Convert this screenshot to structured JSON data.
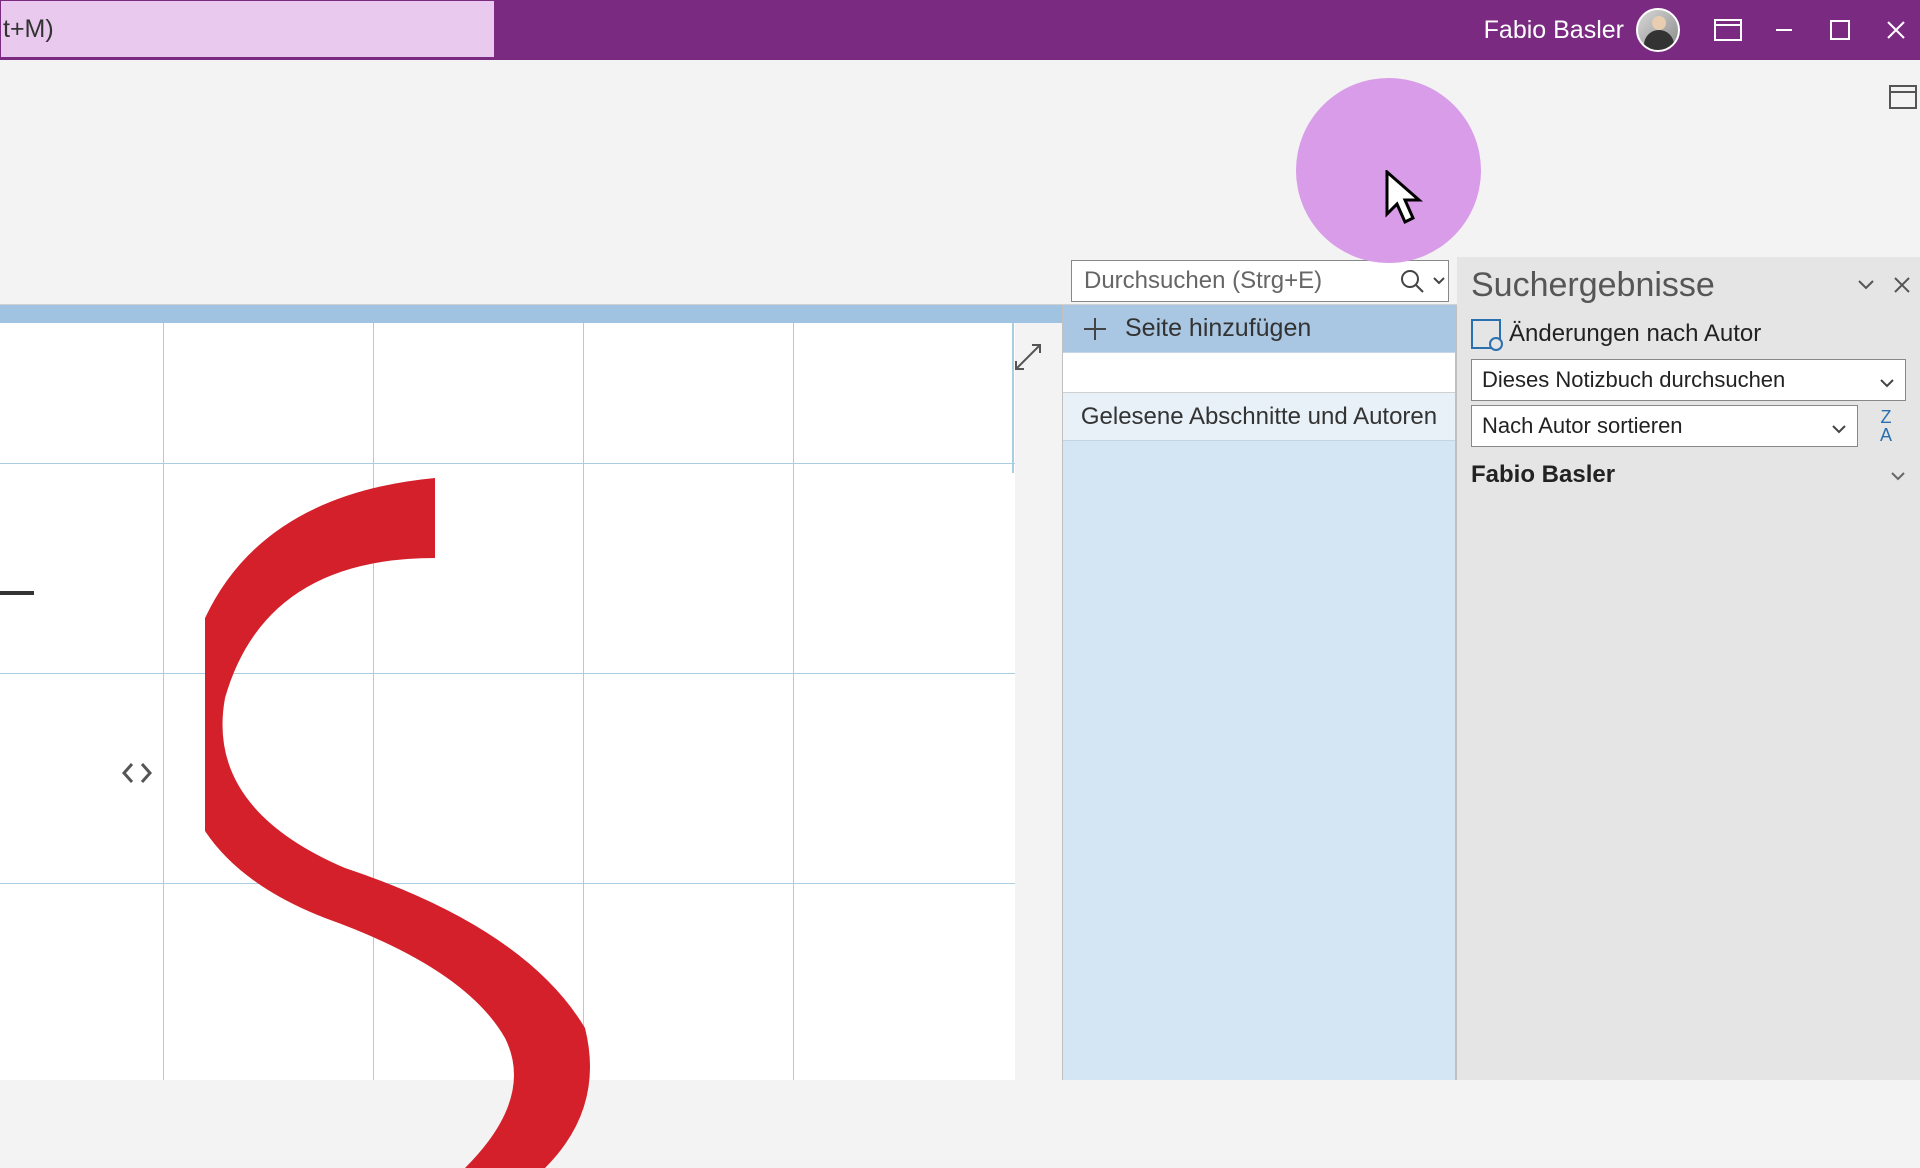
{
  "titlebar": {
    "left_field_text": "t+M)",
    "username": "Fabio Basler"
  },
  "search": {
    "placeholder": "Durchsuchen (Strg+E)"
  },
  "pages": {
    "add_page_label": "Seite hinzufügen",
    "sections_authors_label": "Gelesene Abschnitte und Autoren"
  },
  "results": {
    "title": "Suchergebnisse",
    "changes_by_author": "Änderungen nach Autor",
    "scope_select": "Dieses Notizbuch durchsuchen",
    "sort_select": "Nach Autor sortieren",
    "sort_button_top": "Z",
    "sort_button_bottom": "A",
    "author_name": "Fabio Basler"
  },
  "colors": {
    "accent": "#7b2a82",
    "highlight": "#d89ce8",
    "red": "#d4202a"
  }
}
